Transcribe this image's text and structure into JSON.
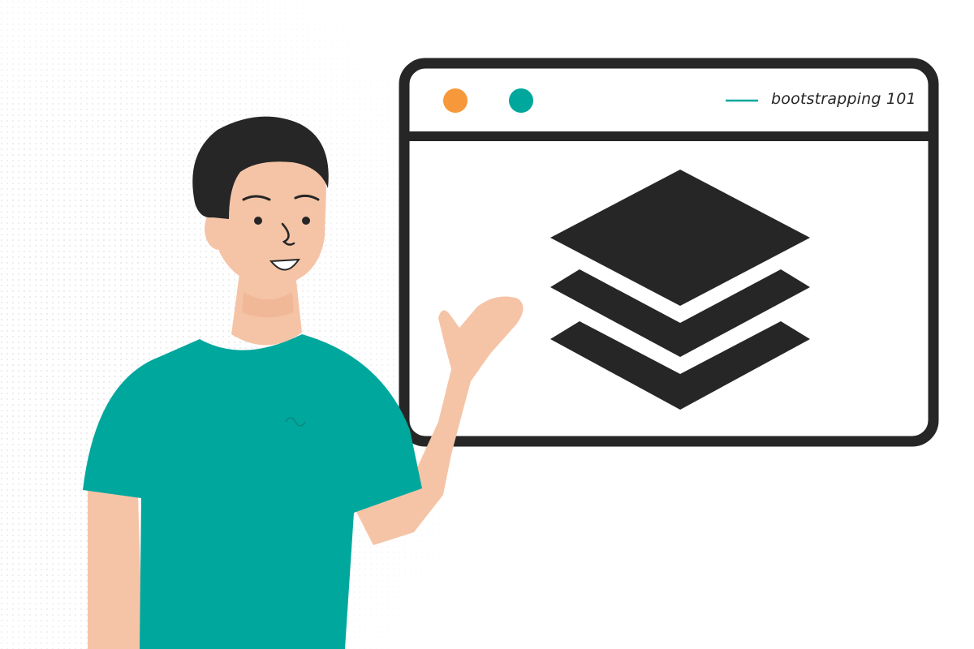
{
  "window": {
    "title": "bootstrapping 101",
    "title_line_color": "#00a79d",
    "frame_color": "#262626",
    "controls": [
      {
        "name": "orange-dot",
        "color": "#f7993a"
      },
      {
        "name": "teal-dot",
        "color": "#00a79d"
      }
    ]
  },
  "content": {
    "icon": "layers-icon"
  },
  "person": {
    "shirt_color": "#00a79d",
    "skin_color": "#f5c4a6",
    "hair_color": "#262626"
  }
}
